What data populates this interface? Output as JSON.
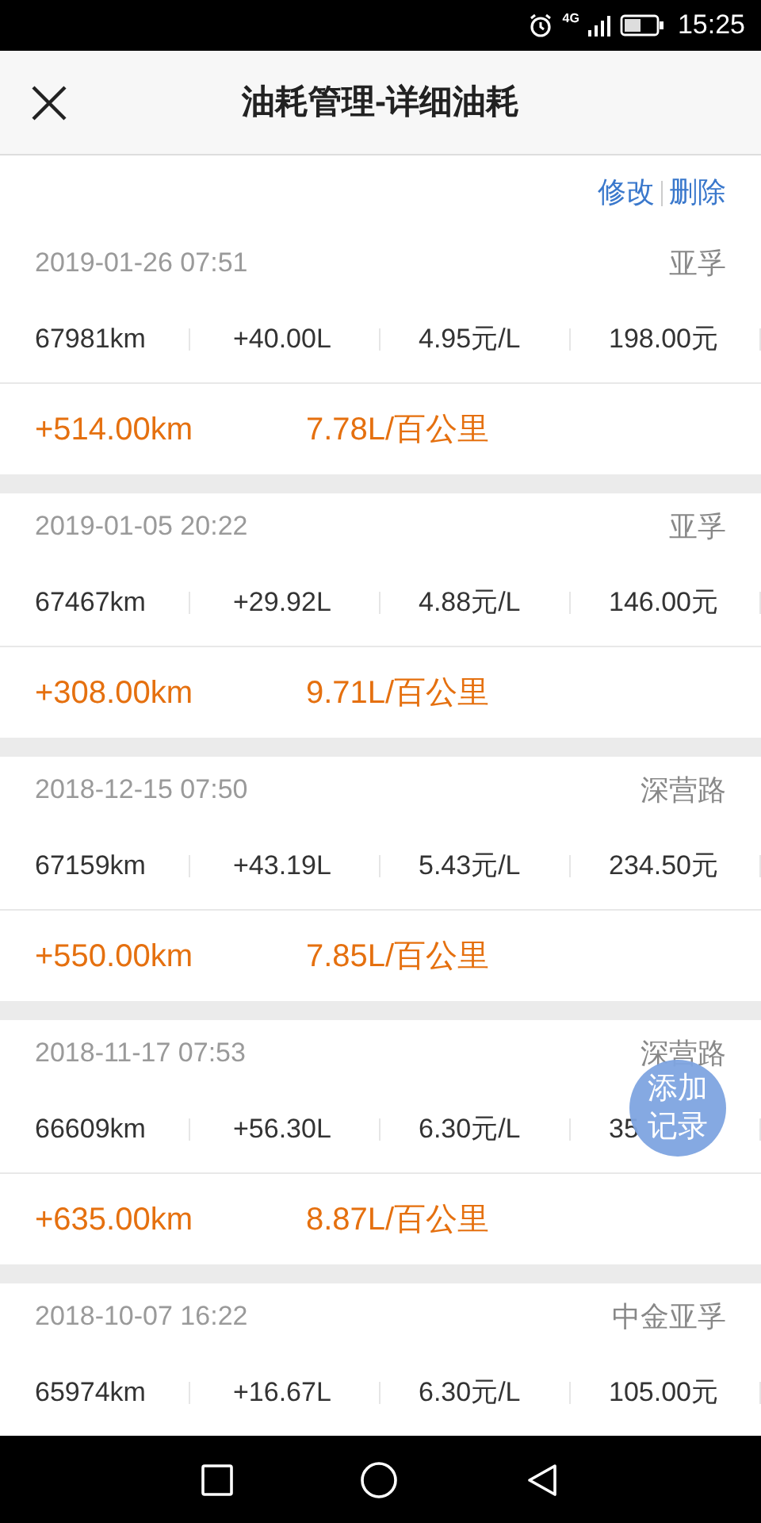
{
  "status_bar": {
    "network": "4G",
    "time": "15:25"
  },
  "header": {
    "title": "油耗管理-详细油耗"
  },
  "actions": [
    "修改",
    "删除"
  ],
  "records": [
    {
      "date": "2019-01-26 07:51",
      "place": "亚孚",
      "odometer": "67981km",
      "fuel": "+40.00L",
      "price": "4.95元/L",
      "amount": "198.00元",
      "distance": "+514.00km",
      "consumption": "7.78L/百公里"
    },
    {
      "date": "2019-01-05 20:22",
      "place": "亚孚",
      "odometer": "67467km",
      "fuel": "+29.92L",
      "price": "4.88元/L",
      "amount": "146.00元",
      "distance": "+308.00km",
      "consumption": "9.71L/百公里"
    },
    {
      "date": "2018-12-15 07:50",
      "place": "深营路",
      "odometer": "67159km",
      "fuel": "+43.19L",
      "price": "5.43元/L",
      "amount": "234.50元",
      "distance": "+550.00km",
      "consumption": "7.85L/百公里"
    },
    {
      "date": "2018-11-17 07:53",
      "place": "深营路",
      "odometer": "66609km",
      "fuel": "+56.30L",
      "price": "6.30元/L",
      "amount": "35",
      "distance": "+635.00km",
      "consumption": "8.87L/百公里"
    },
    {
      "date": "2018-10-07 16:22",
      "place": "中金亚孚",
      "odometer": "65974km",
      "fuel": "+16.67L",
      "price": "6.30元/L",
      "amount": "105.00元"
    }
  ],
  "fab": {
    "label": "添加记录"
  }
}
